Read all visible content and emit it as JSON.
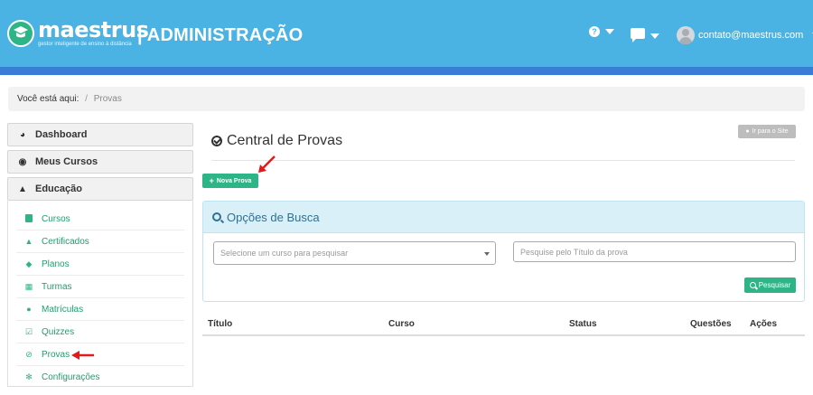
{
  "header": {
    "logo_word": "maestrus",
    "logo_tagline": "gestor inteligente de ensino à distância",
    "title": "| ADMINISTRAÇÃO",
    "help_label": "?",
    "user_email": "contato@maestrus.com",
    "colors": {
      "bar": "#4bb3e3",
      "stripe": "#3a7dd6"
    }
  },
  "breadcrumb": {
    "prefix": "Você está aqui:",
    "separator": "/",
    "current": "Provas"
  },
  "sidebar": {
    "sections": [
      {
        "label": "Dashboard",
        "icon": "dashboard-icon"
      },
      {
        "label": "Meus Cursos",
        "icon": "eye-icon"
      },
      {
        "label": "Educação",
        "icon": "graduation-cap-icon"
      }
    ],
    "items": [
      {
        "label": "Cursos",
        "icon": "book-icon"
      },
      {
        "label": "Certificados",
        "icon": "graduation-cap-icon"
      },
      {
        "label": "Planos",
        "icon": "tags-icon"
      },
      {
        "label": "Turmas",
        "icon": "calendar-icon"
      },
      {
        "label": "Matrículas",
        "icon": "user-icon"
      },
      {
        "label": "Quizzes",
        "icon": "checkbox-icon"
      },
      {
        "label": "Provas",
        "icon": "check-circle-icon"
      },
      {
        "label": "Configurações",
        "icon": "gears-icon"
      }
    ]
  },
  "main": {
    "title": "Central de Provas",
    "site_button": "Ir para o Site",
    "new_button": "Nova Prova",
    "search_panel": {
      "title": "Opções de Busca",
      "course_select_placeholder": "Selecione um curso para pesquisar",
      "title_input_placeholder": "Pesquise pelo Título da prova",
      "search_button": "Pesquisar"
    },
    "table": {
      "columns": [
        "Título",
        "Curso",
        "Status",
        "Questões",
        "Ações"
      ]
    }
  },
  "accent_color": "#2db487"
}
